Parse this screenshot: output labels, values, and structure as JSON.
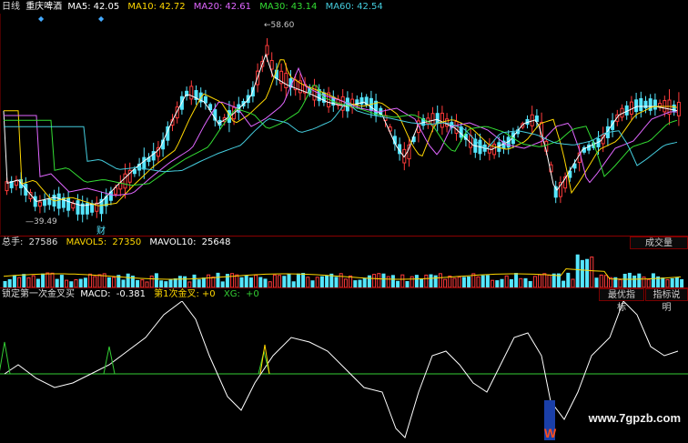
{
  "header": {
    "period": "日线",
    "stock_name": "重庆啤酒",
    "ma": [
      {
        "label": "MA5:",
        "value": "42.05",
        "color": "#ffffff"
      },
      {
        "label": "MA10:",
        "value": "42.72",
        "color": "#ffd700"
      },
      {
        "label": "MA20:",
        "value": "42.61",
        "color": "#e066ff"
      },
      {
        "label": "MA30:",
        "value": "43.14",
        "color": "#33dd33"
      },
      {
        "label": "MA60:",
        "value": "42.54",
        "color": "#44ccdd"
      }
    ]
  },
  "price_chart": {
    "high_label": "58.60",
    "low_label": "39.49",
    "marker_label": "财"
  },
  "volume_panel": {
    "total_label": "总手:",
    "total_value": "27586",
    "mavol5_label": "MAVOL5:",
    "mavol5_value": "27350",
    "mavol10_label": "MAVOL10:",
    "mavol10_value": "25648",
    "button": "成交量"
  },
  "indicator_panel": {
    "name": "锁定第一次金叉买",
    "macd_label": "MACD:",
    "macd_value": "-0.381",
    "cross_label": "第1次金叉:",
    "cross_value": "+0",
    "xg_label": "XG:",
    "xg_value": "+0",
    "btn_optimal": "最优指标",
    "btn_help": "指标说明"
  },
  "watermark": {
    "text": "www.7gpzb.com",
    "logo_char": "W"
  },
  "colors": {
    "up": "#ff3b3b",
    "down": "#55e6ff",
    "grid": "#8a0000",
    "macd_line": "#ffffff",
    "signal": "#33cc33"
  }
}
